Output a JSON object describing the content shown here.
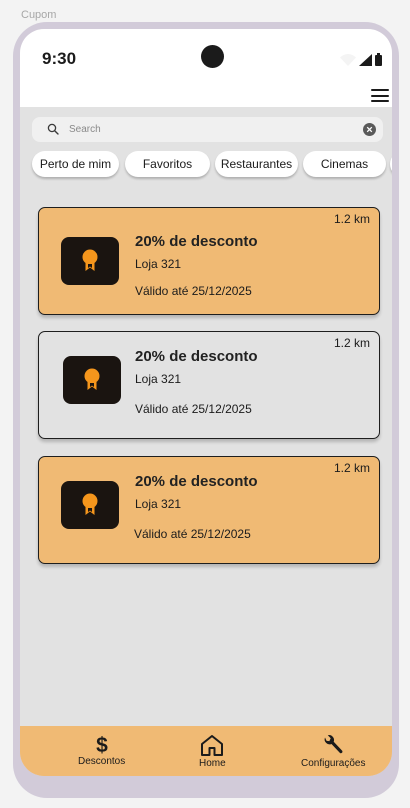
{
  "frame_label": "Cupom",
  "status": {
    "time": "9:30"
  },
  "search": {
    "placeholder": "Search",
    "value": ""
  },
  "chips": [
    "Perto de mim",
    "Favoritos",
    "Restaurantes",
    "Cinemas"
  ],
  "coupons": [
    {
      "distance": "1.2 km",
      "title": "20% de desconto",
      "store": "Loja 321",
      "valid": "Válido até 25/12/2025",
      "style": "highlight"
    },
    {
      "distance": "1.2 km",
      "title": "20% de desconto",
      "store": "Loja 321",
      "valid": "Válido até 25/12/2025",
      "style": "plain"
    },
    {
      "distance": "1.2 km",
      "title": "20% de desconto",
      "store": "Loja 321",
      "valid": "Válido até 25/12/2025",
      "style": "highlight"
    }
  ],
  "nav": {
    "descontos": "Descontos",
    "home": "Home",
    "configuracoes": "Configurações"
  },
  "colors": {
    "accent": "#f0ba74",
    "badge_icon": "#f5961c",
    "badge_bg": "#1a1410",
    "frame": "#d2cbd9"
  },
  "icons": [
    "wifi-icon",
    "signal-icon",
    "battery-icon",
    "menu-icon",
    "search-icon",
    "clear-icon",
    "award-icon",
    "dollar-icon",
    "home-icon",
    "wrench-icon"
  ]
}
